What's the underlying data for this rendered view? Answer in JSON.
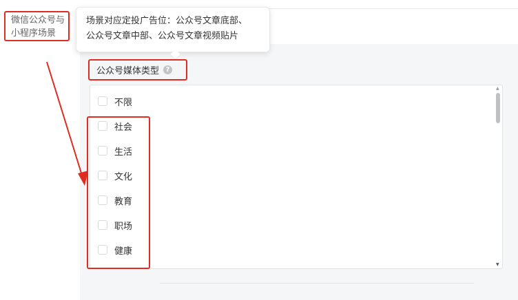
{
  "scene": {
    "line1": "微信公众号与",
    "line2": "小程序场景"
  },
  "tooltip": {
    "line1": "场景对应定投广告位：公众号文章底部、",
    "line2": "公众号文章中部、公众号文章视频贴片"
  },
  "field": {
    "label": "公众号媒体类型",
    "help": "?"
  },
  "options": [
    {
      "label": "不限",
      "checked": true
    },
    {
      "label": "社会",
      "checked": false
    },
    {
      "label": "生活",
      "checked": false
    },
    {
      "label": "文化",
      "checked": false
    },
    {
      "label": "教育",
      "checked": false
    },
    {
      "label": "职场",
      "checked": false
    },
    {
      "label": "健康",
      "checked": false
    }
  ],
  "colors": {
    "annotation_red": "#e02b20",
    "checkbox_blue": "#1f6fe5"
  }
}
